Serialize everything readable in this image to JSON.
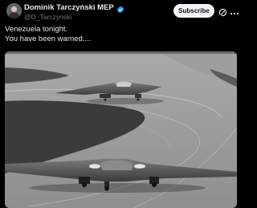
{
  "post": {
    "author": {
      "display_name": "Dominik Tarczyński MEP",
      "handle": "@D_Tarczynski",
      "verified": true,
      "verified_color": "#1d9bf0"
    },
    "actions": {
      "subscribe_label": "Subscribe",
      "grok_icon": "grok-icon",
      "more_icon": "more-horizontal-icon"
    },
    "text_lines": [
      "Venezuela tonight.",
      "You have been warned...."
    ],
    "media": {
      "type": "photo",
      "style": "grayscale",
      "subject_icon": "stealth-bomber-aircraft"
    }
  },
  "colors": {
    "background": "#000000",
    "text_primary": "#e7e9ea",
    "text_secondary": "#71767b",
    "button_bg": "#eff3f4",
    "button_text": "#0f1419"
  }
}
